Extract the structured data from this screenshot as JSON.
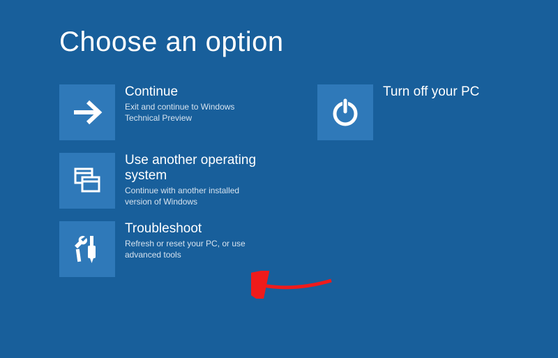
{
  "title": "Choose an option",
  "options": {
    "continue": {
      "title": "Continue",
      "desc": "Exit and continue to Windows Technical Preview"
    },
    "useOther": {
      "title": "Use another operating system",
      "desc": "Continue with another installed version of Windows"
    },
    "troubleshoot": {
      "title": "Troubleshoot",
      "desc": "Refresh or reset your PC, or use advanced tools"
    },
    "turnOff": {
      "title": "Turn off your PC",
      "desc": ""
    }
  }
}
